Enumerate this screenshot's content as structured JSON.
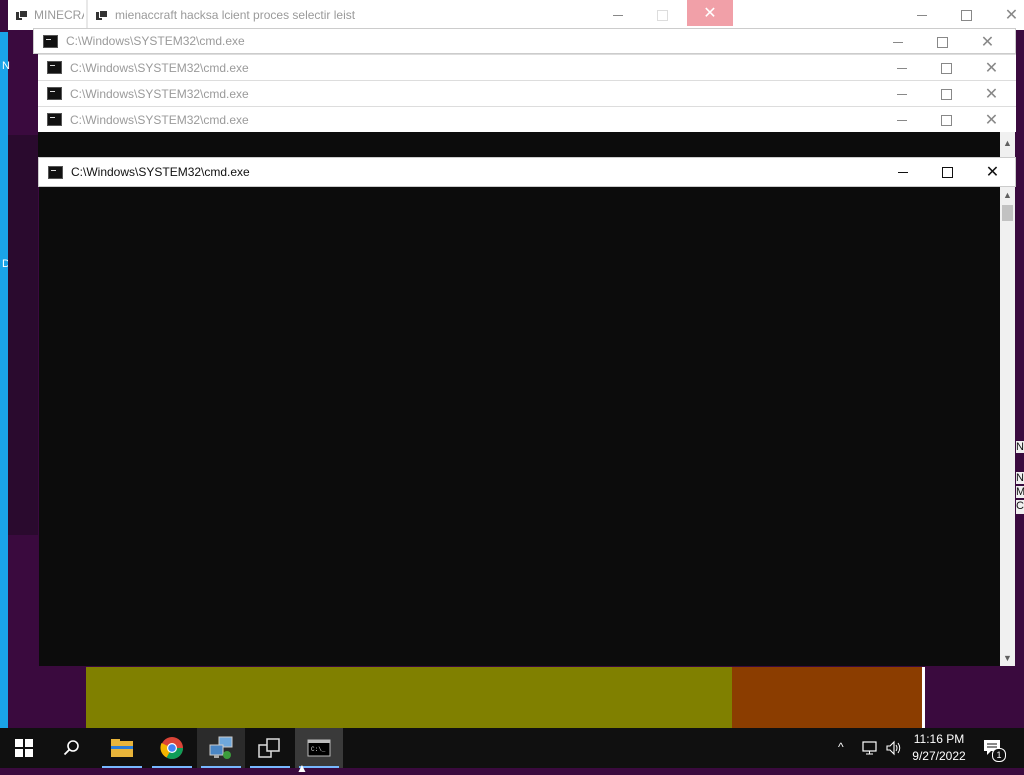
{
  "windows": {
    "minecraft_label": "MINECRA",
    "hacks_title": "mienaccraft hacksa lcient proces selectir leist",
    "cmd_title": "C:\\Windows\\SYSTEM32\\cmd.exe"
  },
  "edge_fragments": {
    "left_top": "N",
    "left_mid": "D",
    "right": [
      "N",
      "N",
      "M",
      "CF"
    ]
  },
  "taskbar": {
    "pinned": [
      "Start",
      "Search",
      "File Explorer",
      "Google Chrome",
      "Network app",
      "Task View",
      "Command Prompt"
    ],
    "clock_time": "11:16 PM",
    "clock_date": "9/27/2022",
    "notification_count": "1"
  },
  "colors": {
    "desktop": "#3a0a3e",
    "console": "#0c0c0c",
    "accent": "#1aa3e8",
    "close_hover": "#f1a0a8"
  }
}
